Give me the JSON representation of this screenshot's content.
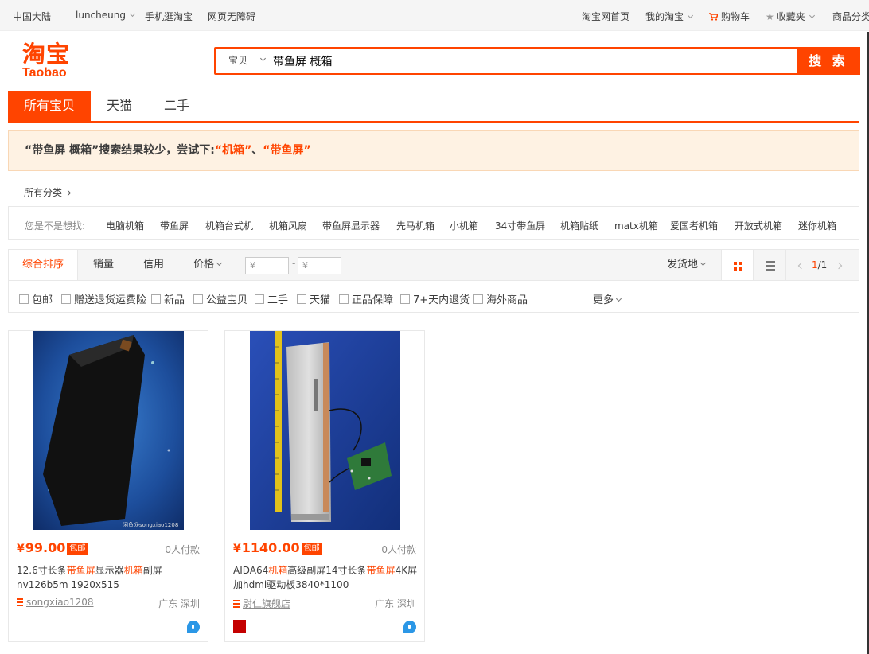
{
  "topbar": {
    "region": "中国大陆",
    "user": "luncheung",
    "mobile": "手机逛淘宝",
    "accessibility": "网页无障碍",
    "home": "淘宝网首页",
    "my_taobao": "我的淘宝",
    "cart": "购物车",
    "favorites": "收藏夹",
    "categories": "商品分类"
  },
  "logo": {
    "cn": "淘宝",
    "en": "Taobao"
  },
  "search": {
    "scope": "宝贝",
    "query": "带鱼屏 概箱",
    "button": "搜 索"
  },
  "tabs": [
    {
      "label": "所有宝贝",
      "active": true
    },
    {
      "label": "天猫",
      "active": false
    },
    {
      "label": "二手",
      "active": false
    }
  ],
  "notice": {
    "prefix": "“带鱼屏 概箱”搜索结果较少，尝试下:",
    "suggestion1": "“机箱”",
    "separator": "、",
    "suggestion2": "“带鱼屏”"
  },
  "all_categories": "所有分类",
  "did_you_mean": {
    "label": "您是不是想找:",
    "keywords": [
      "电脑机箱",
      "带鱼屏",
      "机箱台式机",
      "机箱风扇",
      "带鱼屏显示器",
      "先马机箱",
      "小机箱",
      "34寸带鱼屏",
      "机箱贴纸",
      "matx机箱",
      "爱国者机箱",
      "开放式机箱",
      "迷你机箱"
    ]
  },
  "sort": {
    "default": "综合排序",
    "sales": "销量",
    "credit": "信用",
    "price": "价格",
    "price_min_placeholder": "¥",
    "price_max_placeholder": "¥",
    "price_sep": "-",
    "ship_from": "发货地",
    "page_current": "1",
    "page_total": "/1"
  },
  "filters": {
    "options": [
      "包邮",
      "赠送退货运费险",
      "新品",
      "公益宝贝",
      "二手",
      "天猫",
      "正品保障",
      "7+天内退货",
      "海外商品"
    ],
    "more": "更多"
  },
  "products": [
    {
      "yen": "¥",
      "price": "99.00",
      "badge": "包邮",
      "deals": "0人付款",
      "title_parts": [
        "12.6寸长条",
        "带鱼屏",
        "显示器",
        "机箱",
        "副屏nv126b5m 1920x515"
      ],
      "shop": "songxiao1208",
      "location": "广东 深圳",
      "watermark": "闲鱼@songxiao1208"
    },
    {
      "yen": "¥",
      "price": "1140.00",
      "badge": "包邮",
      "deals": "0人付款",
      "title_parts": [
        "AIDA64",
        "机箱",
        "高级副屏14寸长条",
        "带鱼屏",
        "4K屏加hdmi驱动板3840*1100"
      ],
      "shop": "尉仁旗舰店",
      "location": "广东 深圳"
    }
  ],
  "colors": {
    "accent": "#ff4400",
    "notice_bg": "#fef2e3",
    "wangwang": "#2b97e6"
  }
}
